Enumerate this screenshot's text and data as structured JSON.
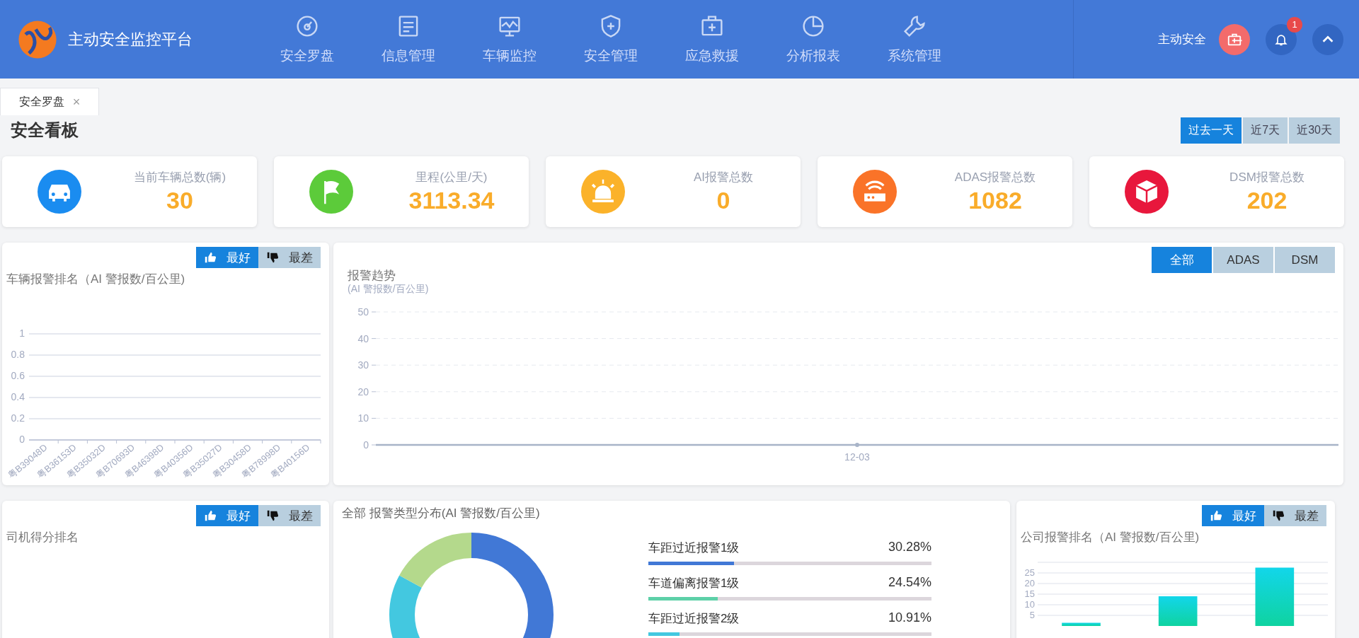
{
  "header": {
    "title": "主动安全监控平台",
    "nav": [
      {
        "label": "安全罗盘"
      },
      {
        "label": "信息管理"
      },
      {
        "label": "车辆监控"
      },
      {
        "label": "安全管理"
      },
      {
        "label": "应急救援"
      },
      {
        "label": "分析报表"
      },
      {
        "label": "系统管理"
      }
    ],
    "user": "主动安全",
    "badge": "1"
  },
  "tabs": [
    {
      "label": "安全罗盘",
      "close": "×"
    }
  ],
  "board": {
    "title": "安全看板",
    "ranges": [
      {
        "label": "过去一天",
        "selected": true
      },
      {
        "label": "近7天",
        "selected": false
      },
      {
        "label": "近30天",
        "selected": false
      }
    ]
  },
  "kpis": [
    {
      "label": "当前车辆总数(辆)",
      "value": "30",
      "color": "#1a8cf0"
    },
    {
      "label": "里程(公里/天)",
      "value": "3113.34",
      "color": "#5ccb3a"
    },
    {
      "label": "AI报警总数",
      "value": "0",
      "color": "#fbb22a"
    },
    {
      "label": "ADAS报警总数",
      "value": "1082",
      "color": "#fa7328"
    },
    {
      "label": "DSM报警总数",
      "value": "202",
      "color": "#e8173c"
    }
  ],
  "vehicle_ranking": {
    "toggle": [
      {
        "label": "最好",
        "selected": true
      },
      {
        "label": "最差",
        "selected": false
      }
    ],
    "chart_data": {
      "type": "bar",
      "title": "车辆报警排名（AI 警报数/百公里)",
      "categories": [
        "粤B39048D",
        "粤B36153D",
        "粤B35032D",
        "粤B70693D",
        "粤B46398D",
        "粤B40356D",
        "粤B35027D",
        "粤B30458D",
        "粤B78998D",
        "粤B40156D"
      ],
      "values": [
        0,
        0,
        0,
        0,
        0,
        0,
        0,
        0,
        0,
        0
      ],
      "ylim": [
        0,
        1
      ],
      "yticks": [
        0,
        0.2,
        0.4,
        0.6,
        0.8,
        1
      ],
      "grid": true
    }
  },
  "alarm_trend": {
    "types": [
      {
        "label": "全部",
        "selected": true
      },
      {
        "label": "ADAS",
        "selected": false
      },
      {
        "label": "DSM",
        "selected": false
      }
    ],
    "chart_data": {
      "type": "line",
      "title": "报警趋势",
      "ylabel": "(AI 警报数/百公里)",
      "x": [
        "12-03"
      ],
      "values": [
        0
      ],
      "ylim": [
        0,
        50
      ],
      "yticks": [
        0,
        10,
        20,
        30,
        40,
        50
      ],
      "grid": true,
      "marker": true
    }
  },
  "driver_ranking": {
    "title": "司机得分排名",
    "toggle": [
      {
        "label": "最好",
        "selected": true
      },
      {
        "label": "最差",
        "selected": false
      }
    ]
  },
  "type_distribution": {
    "title": "全部 报警类型分布(AI 警报数/百公里)",
    "items": [
      {
        "name": "车距过近报警1级",
        "percent": "30.28%",
        "level": 0.3028,
        "color": "#4178d6"
      },
      {
        "name": "车道偏离报警1级",
        "percent": "24.54%",
        "level": 0.2454,
        "color": "#5dd0a8"
      },
      {
        "name": "车距过近报警2级",
        "percent": "10.91%",
        "level": 0.1091,
        "color": "#43c8e0"
      }
    ]
  },
  "company_ranking": {
    "toggle": [
      {
        "label": "最好",
        "selected": true
      },
      {
        "label": "最差",
        "selected": false
      }
    ],
    "chart_data": {
      "type": "bar",
      "title": "公司报警排名（AI 警报数/百公里)",
      "values": [
        1.5,
        14,
        27.5
      ],
      "ylim": [
        0,
        30
      ],
      "yticks": [
        5,
        10,
        15,
        20,
        25
      ],
      "grid": true
    }
  }
}
